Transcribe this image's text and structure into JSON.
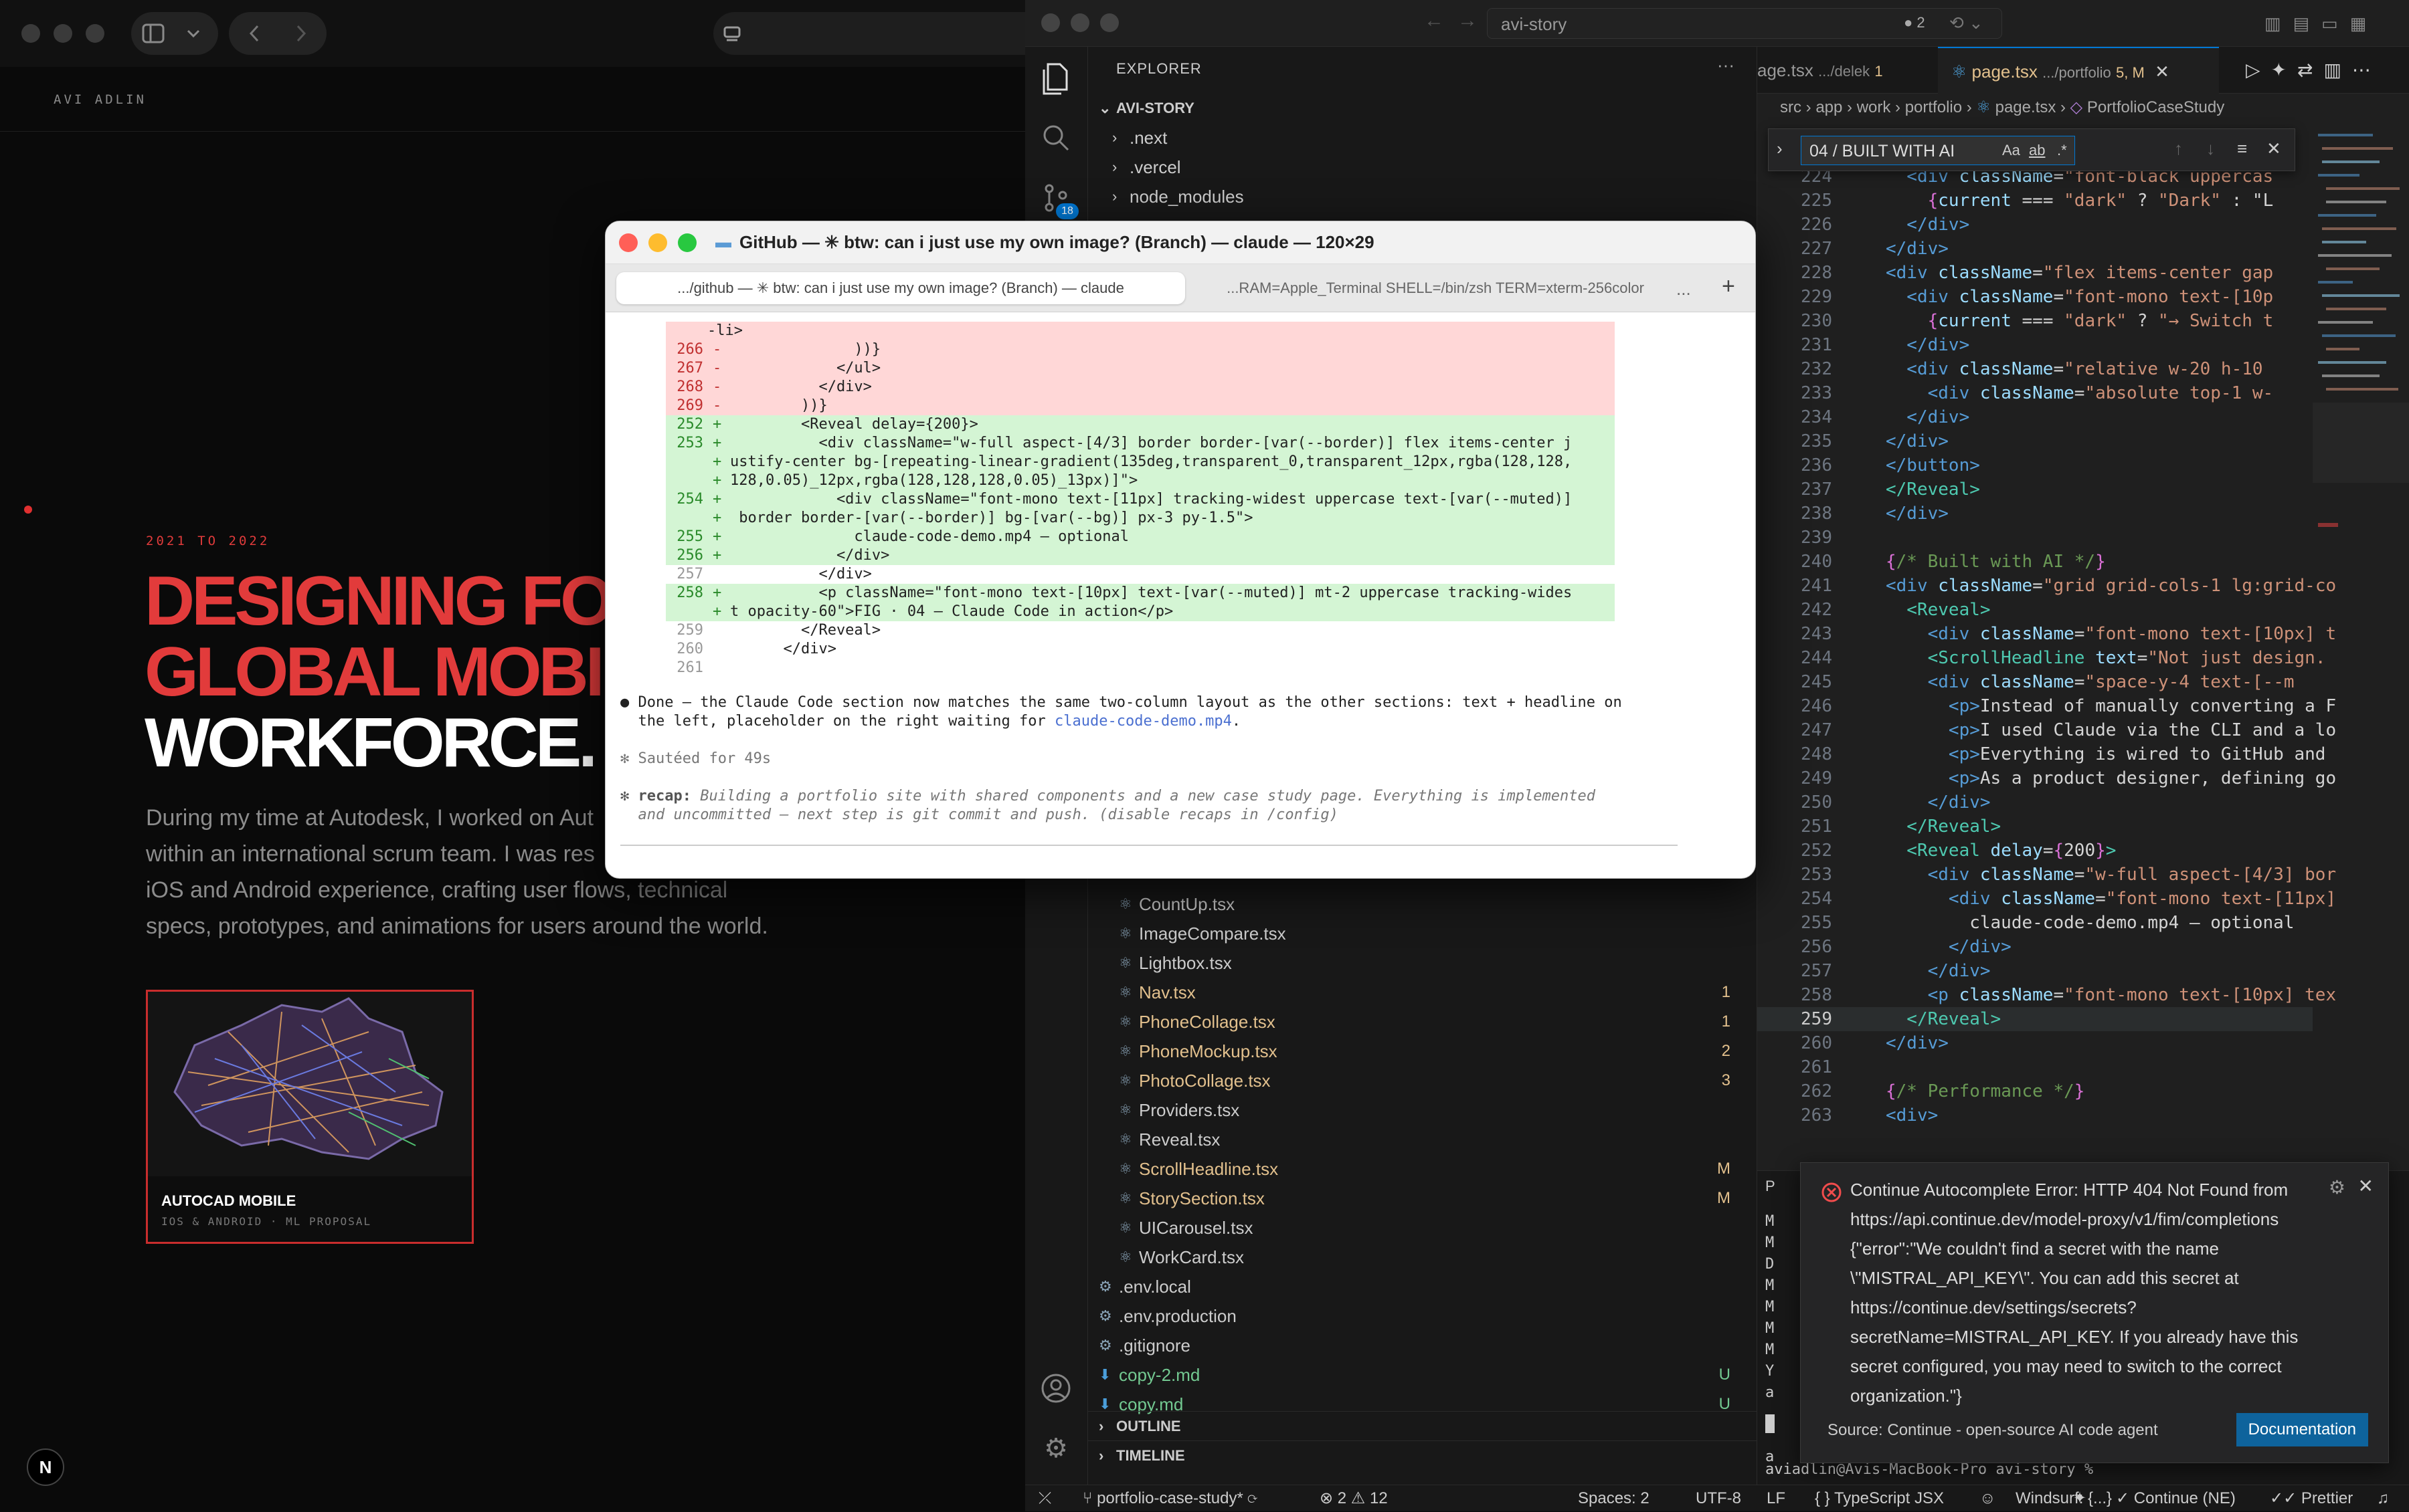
{
  "browser": {
    "site_name": "AVI ADLIN",
    "years": "2021 TO 2022",
    "headline": [
      "DESIGNING FO",
      "GLOBAL MOBI",
      "WORKFORCE."
    ],
    "intro": [
      "During my time at Autodesk, I worked on Aut",
      "within an international scrum team. I was res",
      "iOS and Android experience, crafting user flows, technical",
      "specs, prototypes, and animations for users around the world."
    ],
    "card_title": "AUTOCAD MOBILE",
    "card_subtitle": "IOS & ANDROID · ML PROPOSAL",
    "n_badge": "N"
  },
  "vscode": {
    "title_search": "avi-story",
    "title_counter": "2",
    "explorer_label": "EXPLORER",
    "project": "AVI-STORY",
    "folders": [
      ".next",
      ".vercel",
      "node_modules"
    ],
    "scm_badge": "18",
    "files": [
      {
        "name": "CountUp.tsx",
        "badge": "",
        "color": "#cccccc"
      },
      {
        "name": "ImageCompare.tsx",
        "badge": "",
        "color": "#cccccc"
      },
      {
        "name": "Lightbox.tsx",
        "badge": "",
        "color": "#cccccc"
      },
      {
        "name": "Nav.tsx",
        "badge": "1",
        "color": "#e2c08d"
      },
      {
        "name": "PhoneCollage.tsx",
        "badge": "1",
        "color": "#e2c08d"
      },
      {
        "name": "PhoneMockup.tsx",
        "badge": "2",
        "color": "#e2c08d"
      },
      {
        "name": "PhotoCollage.tsx",
        "badge": "3",
        "color": "#e2c08d"
      },
      {
        "name": "Providers.tsx",
        "badge": "",
        "color": "#cccccc"
      },
      {
        "name": "Reveal.tsx",
        "badge": "",
        "color": "#cccccc"
      },
      {
        "name": "ScrollHeadline.tsx",
        "badge": "M",
        "color": "#e2c08d"
      },
      {
        "name": "StorySection.tsx",
        "badge": "M",
        "color": "#e2c08d"
      },
      {
        "name": "UICarousel.tsx",
        "badge": "",
        "color": "#cccccc"
      },
      {
        "name": "WorkCard.tsx",
        "badge": "",
        "color": "#cccccc"
      }
    ],
    "root_files": [
      {
        "name": ".env.local",
        "badge": "",
        "color": "#cccccc"
      },
      {
        "name": ".env.production",
        "badge": "",
        "color": "#cccccc"
      },
      {
        "name": ".gitignore",
        "badge": "",
        "color": "#cccccc"
      },
      {
        "name": "copy-2.md",
        "badge": "U",
        "color": "#73c991"
      },
      {
        "name": "copy.md",
        "badge": "U",
        "color": "#73c991"
      }
    ],
    "outline": "OUTLINE",
    "timeline": "TIMELINE",
    "tabs": [
      {
        "label": "age.tsx",
        "path": ".../delek",
        "badge": "1"
      },
      {
        "label": "page.tsx",
        "path": ".../portfolio",
        "badge": "5, M"
      }
    ],
    "breadcrumb": [
      "src",
      "app",
      "work",
      "portfolio",
      "page.tsx",
      "PortfolioCaseStudy"
    ],
    "find_value": "04 / BUILT WITH AI",
    "find_opts": [
      "Aa",
      "ab",
      ".*"
    ],
    "code": [
      {
        "n": "224",
        "c": [
          [
            "tg",
            "  <div "
          ],
          [
            "at",
            "className"
          ],
          [
            "tx",
            "="
          ],
          [
            "st",
            "\"font-black uppercas"
          ]
        ]
      },
      {
        "n": "225",
        "c": [
          [
            "br",
            "    {"
          ],
          [
            "at",
            "current"
          ],
          [
            "tx",
            " === "
          ],
          [
            "st",
            "\"dark\""
          ],
          [
            "tx",
            " ? "
          ],
          [
            "st",
            "\"Dark\""
          ],
          [
            "tx",
            " : \"L"
          ]
        ]
      },
      {
        "n": "226",
        "c": [
          [
            "tg",
            "  </div>"
          ]
        ]
      },
      {
        "n": "227",
        "c": [
          [
            "tg",
            "</div>"
          ]
        ]
      },
      {
        "n": "228",
        "c": [
          [
            "tg",
            "<div "
          ],
          [
            "at",
            "className"
          ],
          [
            "tx",
            "="
          ],
          [
            "st",
            "\"flex items-center gap"
          ]
        ]
      },
      {
        "n": "229",
        "c": [
          [
            "tg",
            "  <div "
          ],
          [
            "at",
            "className"
          ],
          [
            "tx",
            "="
          ],
          [
            "st",
            "\"font-mono text-[10p"
          ]
        ]
      },
      {
        "n": "230",
        "c": [
          [
            "br",
            "    {"
          ],
          [
            "at",
            "current"
          ],
          [
            "tx",
            " === "
          ],
          [
            "st",
            "\"dark\""
          ],
          [
            "tx",
            " ? "
          ],
          [
            "st",
            "\"→ Switch t"
          ]
        ]
      },
      {
        "n": "231",
        "c": [
          [
            "tg",
            "  </div>"
          ]
        ]
      },
      {
        "n": "232",
        "c": [
          [
            "tg",
            "  <div "
          ],
          [
            "at",
            "className"
          ],
          [
            "tx",
            "="
          ],
          [
            "st",
            "\"relative w-20 h-10"
          ]
        ]
      },
      {
        "n": "233",
        "c": [
          [
            "tg",
            "    <div "
          ],
          [
            "at",
            "className"
          ],
          [
            "tx",
            "="
          ],
          [
            "st",
            "\"absolute top-1 w-"
          ]
        ]
      },
      {
        "n": "234",
        "c": [
          [
            "tg",
            "  </div>"
          ]
        ]
      },
      {
        "n": "235",
        "c": [
          [
            "tg",
            "</div>"
          ]
        ]
      },
      {
        "n": "236",
        "c": [
          [
            "tg",
            "</button>"
          ]
        ]
      },
      {
        "n": "237",
        "c": [
          [
            "cy",
            "</Reveal>"
          ]
        ]
      },
      {
        "n": "238",
        "c": [
          [
            "tg",
            "</div>"
          ]
        ]
      },
      {
        "n": "239",
        "c": [
          [
            "tx",
            ""
          ]
        ]
      },
      {
        "n": "240",
        "c": [
          [
            "br",
            "{"
          ],
          [
            "cm",
            "/* Built with AI */"
          ],
          [
            "br",
            "}"
          ]
        ]
      },
      {
        "n": "241",
        "c": [
          [
            "tg",
            "<div "
          ],
          [
            "at",
            "className"
          ],
          [
            "tx",
            "="
          ],
          [
            "st",
            "\"grid grid-cols-1 lg:grid-co"
          ]
        ]
      },
      {
        "n": "242",
        "c": [
          [
            "cy",
            "  <Reveal>"
          ]
        ]
      },
      {
        "n": "243",
        "c": [
          [
            "tg",
            "    <div "
          ],
          [
            "at",
            "className"
          ],
          [
            "tx",
            "="
          ],
          [
            "st",
            "\"font-mono text-[10px] t"
          ]
        ]
      },
      {
        "n": "244",
        "c": [
          [
            "cy",
            "    <ScrollHeadline "
          ],
          [
            "at",
            "text"
          ],
          [
            "tx",
            "="
          ],
          [
            "st",
            "\"Not just design."
          ]
        ]
      },
      {
        "n": "245",
        "c": [
          [
            "tg",
            "    <div "
          ],
          [
            "at",
            "className"
          ],
          [
            "tx",
            "="
          ],
          [
            "st",
            "\"space-y-4 text-[--m"
          ]
        ]
      },
      {
        "n": "246",
        "c": [
          [
            "tg",
            "      <p>"
          ],
          [
            "tx",
            "Instead of manually converting a F"
          ]
        ]
      },
      {
        "n": "247",
        "c": [
          [
            "tg",
            "      <p>"
          ],
          [
            "tx",
            "I used Claude via the CLI and a lo"
          ]
        ]
      },
      {
        "n": "248",
        "c": [
          [
            "tg",
            "      <p>"
          ],
          [
            "tx",
            "Everything is wired to GitHub and"
          ]
        ]
      },
      {
        "n": "249",
        "c": [
          [
            "tg",
            "      <p>"
          ],
          [
            "tx",
            "As a product designer, defining go"
          ]
        ]
      },
      {
        "n": "250",
        "c": [
          [
            "tg",
            "    </div>"
          ]
        ]
      },
      {
        "n": "251",
        "c": [
          [
            "cy",
            "  </Reveal>"
          ]
        ]
      },
      {
        "n": "252",
        "c": [
          [
            "cy",
            "  <Reveal "
          ],
          [
            "at",
            "delay"
          ],
          [
            "tx",
            "="
          ],
          [
            "br",
            "{"
          ],
          [
            "tx",
            "200"
          ],
          [
            "br",
            "}"
          ],
          [
            "cy",
            ">"
          ]
        ]
      },
      {
        "n": "253",
        "c": [
          [
            "tg",
            "    <div "
          ],
          [
            "at",
            "className"
          ],
          [
            "tx",
            "="
          ],
          [
            "st",
            "\"w-full aspect-[4/3] bor"
          ]
        ]
      },
      {
        "n": "254",
        "c": [
          [
            "tg",
            "      <div "
          ],
          [
            "at",
            "className"
          ],
          [
            "tx",
            "="
          ],
          [
            "st",
            "\"font-mono text-[11px]"
          ]
        ]
      },
      {
        "n": "255",
        "c": [
          [
            "tx",
            "        claude-code-demo.mp4 — optional"
          ]
        ]
      },
      {
        "n": "256",
        "c": [
          [
            "tg",
            "      </div>"
          ]
        ]
      },
      {
        "n": "257",
        "c": [
          [
            "tg",
            "    </div>"
          ]
        ]
      },
      {
        "n": "258",
        "c": [
          [
            "tg",
            "    <p "
          ],
          [
            "at",
            "className"
          ],
          [
            "tx",
            "="
          ],
          [
            "st",
            "\"font-mono text-[10px] tex"
          ]
        ]
      },
      {
        "n": "259",
        "c": [
          [
            "cy",
            "  </Reveal>"
          ]
        ]
      },
      {
        "n": "260",
        "c": [
          [
            "tg",
            "</div>"
          ]
        ]
      },
      {
        "n": "261",
        "c": [
          [
            "tx",
            ""
          ]
        ]
      },
      {
        "n": "262",
        "c": [
          [
            "br",
            "{"
          ],
          [
            "cm",
            "/* Performance */"
          ],
          [
            "br",
            "}"
          ]
        ]
      },
      {
        "n": "263",
        "c": [
          [
            "tg",
            "<div>"
          ]
        ]
      }
    ],
    "terminal_side": [
      "M",
      "M",
      "D",
      "M",
      "M",
      "M",
      "M",
      "Y",
      "a",
      "",
      "",
      "a"
    ],
    "terminal_prompt": "aviadlin@Avis-MacBook-Pro avi-story %",
    "notification": {
      "message": "Continue Autocomplete Error: HTTP 404 Not Found from https://api.continue.dev/model-proxy/v1/fim/completions {\"error\":\"We couldn't find a secret with the name \\\"MISTRAL_API_KEY\\\". You can add this secret at https://continue.dev/settings/secrets?secretName=MISTRAL_API_KEY. If you already have this secret configured, you may need to switch to the correct organization.\"}",
      "source": "Source: Continue - open-source AI code agent",
      "button": "Documentation"
    },
    "status": {
      "branch": "portfolio-case-study*",
      "errors": "2",
      "warnings": "12",
      "spaces": "Spaces: 2",
      "encoding": "UTF-8",
      "eol": "LF",
      "language": "TypeScript JSX",
      "windsurf": "Windsurf: {...}",
      "continue": "Continue (NE)",
      "prettier": "Prettier"
    }
  },
  "terminal": {
    "title": "GitHub — ✳ btw: can i just use my own image? (Branch) — claude — 120×29",
    "tab1": ".../github — ✳ btw: can i just use my own image? (Branch) — claude",
    "tab2": "...RAM=Apple_Terminal SHELL=/bin/zsh TERM=xterm-256color",
    "tab_more": "...",
    "tab_add": "+",
    "diff": [
      {
        "t": "del",
        "n": "",
        "s": "",
        "c": "-li>"
      },
      {
        "t": "del",
        "n": "266",
        "s": "-",
        "c": "              ))}"
      },
      {
        "t": "del",
        "n": "267",
        "s": "-",
        "c": "            </ul>"
      },
      {
        "t": "del",
        "n": "268",
        "s": "-",
        "c": "          </div>"
      },
      {
        "t": "del",
        "n": "269",
        "s": "-",
        "c": "        ))}"
      },
      {
        "t": "add",
        "n": "252",
        "s": "+",
        "c": "        <Reveal delay={200}>"
      },
      {
        "t": "add",
        "n": "253",
        "s": "+",
        "c": "          <div className=\"w-full aspect-[4/3] border border-[var(--border)] flex items-center j"
      },
      {
        "t": "add",
        "n": "",
        "s": "+",
        "c": "ustify-center bg-[repeating-linear-gradient(135deg,transparent_0,transparent_12px,rgba(128,128,"
      },
      {
        "t": "add",
        "n": "",
        "s": "+",
        "c": "128,0.05)_12px,rgba(128,128,128,0.05)_13px)]\">"
      },
      {
        "t": "add",
        "n": "254",
        "s": "+",
        "c": "            <div className=\"font-mono text-[11px] tracking-widest uppercase text-[var(--muted)]"
      },
      {
        "t": "add",
        "n": "",
        "s": "+",
        "c": " border border-[var(--border)] bg-[var(--bg)] px-3 py-1.5\">"
      },
      {
        "t": "add",
        "n": "255",
        "s": "+",
        "c": "              claude-code-demo.mp4 — optional"
      },
      {
        "t": "add",
        "n": "256",
        "s": "+",
        "c": "            </div>"
      },
      {
        "t": "ctx",
        "n": "257",
        "s": "",
        "c": "          </div>"
      },
      {
        "t": "add",
        "n": "258",
        "s": "+",
        "c": "          <p className=\"font-mono text-[10px] text-[var(--muted)] mt-2 uppercase tracking-wides"
      },
      {
        "t": "add",
        "n": "",
        "s": "+",
        "c": "t opacity-60\">FIG · 04 — Claude Code in action</p>"
      },
      {
        "t": "ctx",
        "n": "259",
        "s": "",
        "c": "        </Reveal>"
      },
      {
        "t": "ctx",
        "n": "260",
        "s": "",
        "c": "      </div>"
      },
      {
        "t": "ctx",
        "n": "261",
        "s": "",
        "c": ""
      }
    ],
    "done_1": "● Done — the Claude Code section now matches the same two-column layout as the other sections: text + headline on",
    "done_2": "  the left, placeholder on the right waiting for ",
    "done_file": "claude-code-demo.mp4",
    "done_end": ".",
    "sauteed": "✻ Sautéed for 49s",
    "recap_label": "✻ recap:",
    "recap_1": " Building a portfolio site with shared components and a new case study page. Everything is implemented",
    "recap_2": "  and uncommitted — next step is git commit and push. (disable recaps in /config)"
  }
}
